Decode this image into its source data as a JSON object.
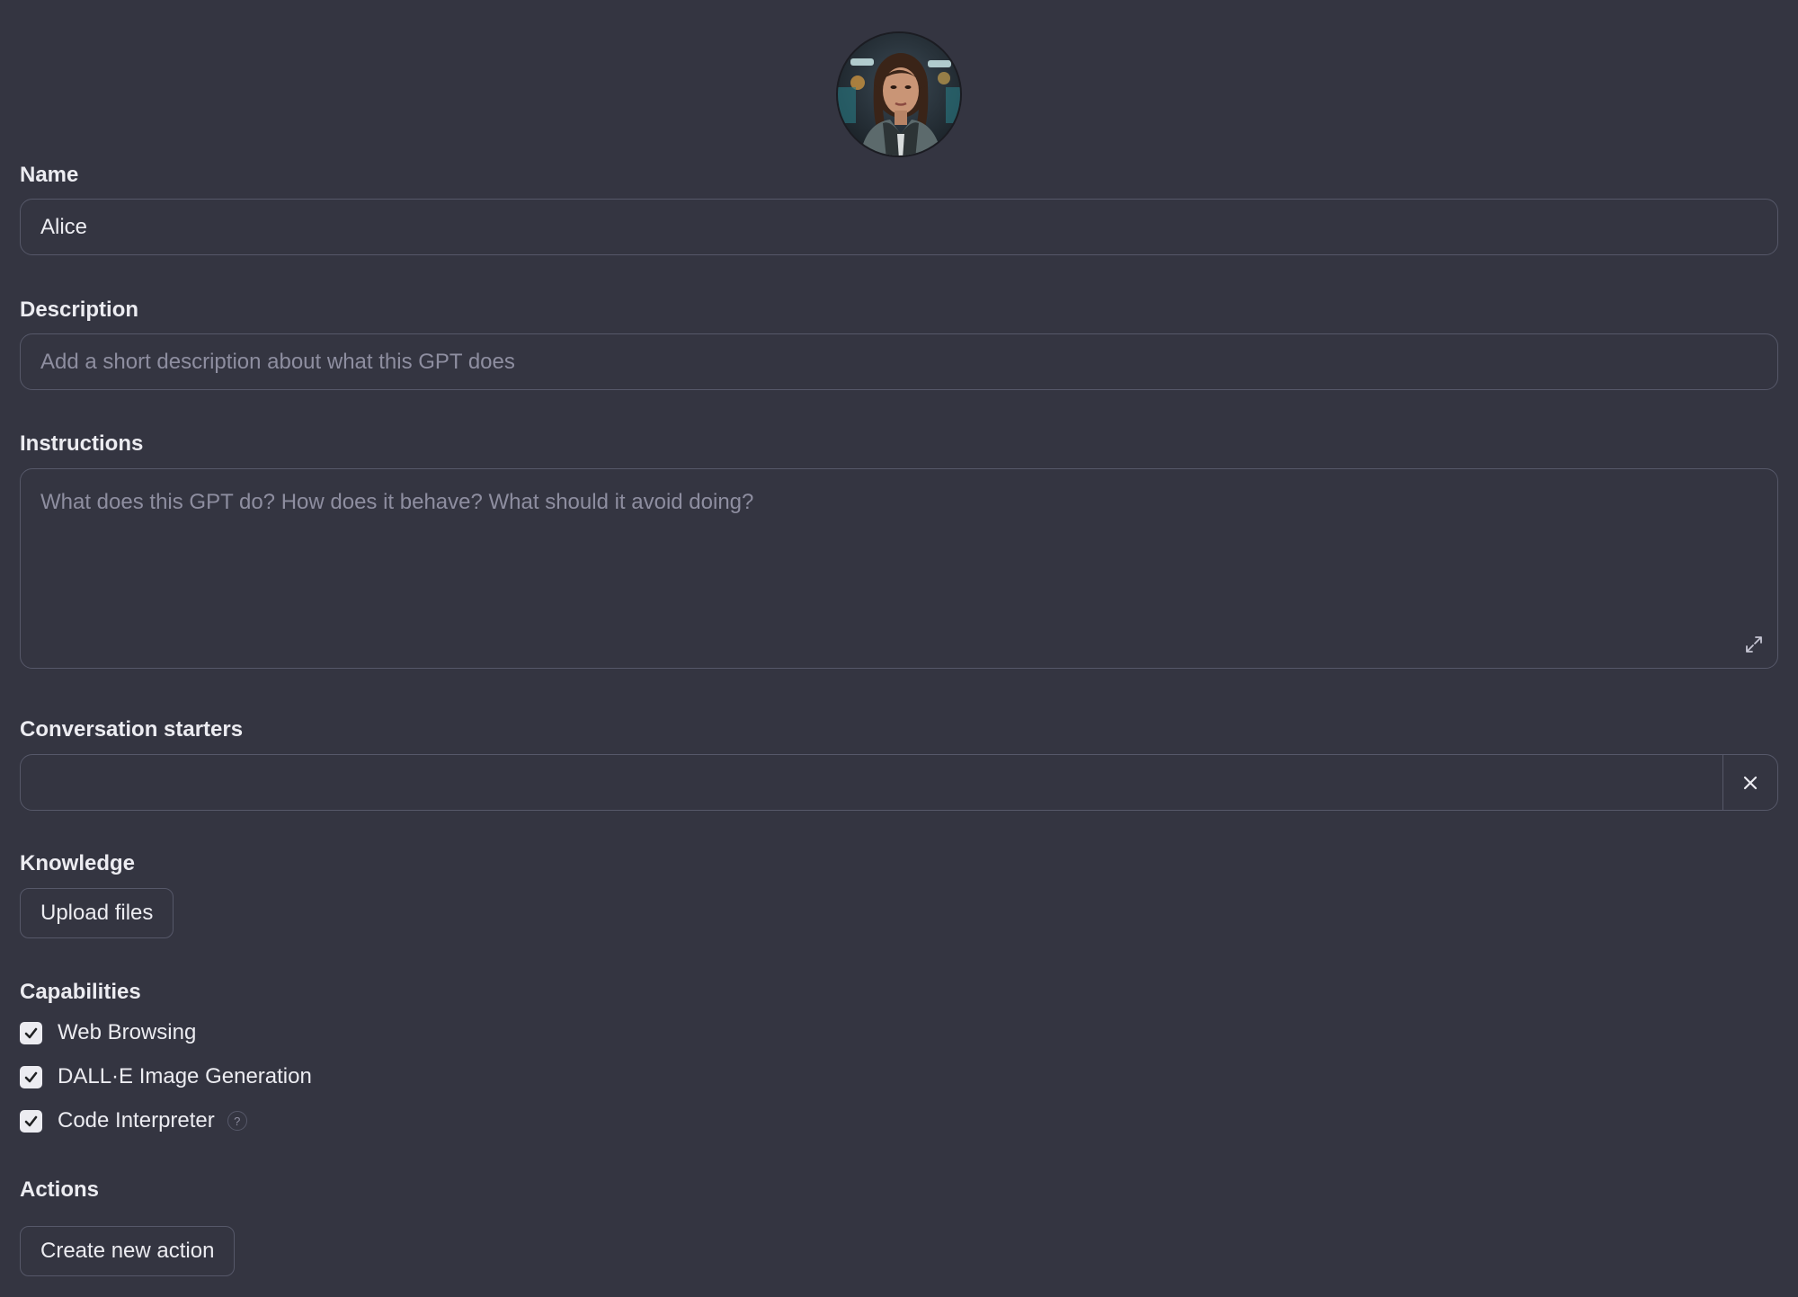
{
  "avatar": {
    "alt": "GPT profile picture"
  },
  "name": {
    "label": "Name",
    "value": "Alice"
  },
  "description": {
    "label": "Description",
    "placeholder": "Add a short description about what this GPT does"
  },
  "instructions": {
    "label": "Instructions",
    "placeholder": "What does this GPT do? How does it behave? What should it avoid doing?"
  },
  "starters": {
    "label": "Conversation starters",
    "value": ""
  },
  "knowledge": {
    "label": "Knowledge",
    "upload_label": "Upload files"
  },
  "capabilities": {
    "label": "Capabilities",
    "items": [
      {
        "label": "Web Browsing",
        "checked": true
      },
      {
        "label": "DALL·E Image Generation",
        "checked": true
      },
      {
        "label": "Code Interpreter",
        "checked": true,
        "help": "?"
      }
    ]
  },
  "actions": {
    "label": "Actions",
    "create_label": "Create new action"
  },
  "colors": {
    "background": "#343541",
    "border": "#565869",
    "text": "#ececf1",
    "placeholder": "#8e8ea0"
  }
}
